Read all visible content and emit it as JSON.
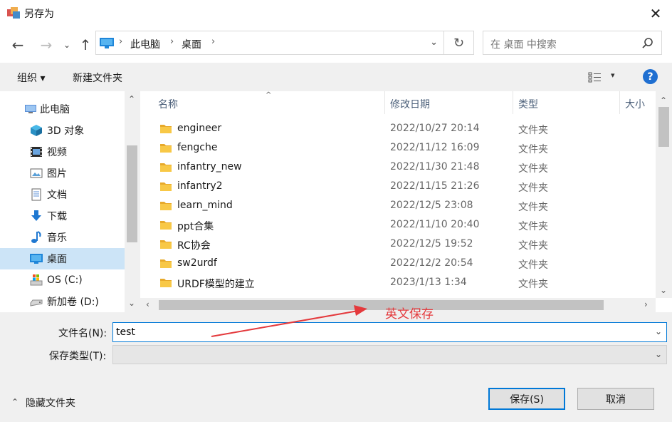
{
  "window": {
    "title": "另存为",
    "close_glyph": "✕"
  },
  "nav": {
    "back_glyph": "←",
    "forward_glyph": "→",
    "recent_glyph": "⌄",
    "up_glyph": "↑",
    "chevron_glyph": "›",
    "breadcrumbs": [
      "此电脑",
      "桌面"
    ],
    "dropdown_glyph": "⌄",
    "refresh_glyph": "↻",
    "search_placeholder": "在 桌面 中搜索"
  },
  "toolbar": {
    "organize_label": "组织 ▾",
    "new_folder_label": "新建文件夹",
    "view_arrow": "▾",
    "help_glyph": "?"
  },
  "sidebar": {
    "scroll_up": "⌃",
    "scroll_down": "⌄",
    "items": [
      {
        "label": "此电脑",
        "icon": "computer-icon",
        "selected": false
      },
      {
        "label": "3D 对象",
        "icon": "3d-objects-icon",
        "selected": false
      },
      {
        "label": "视频",
        "icon": "video-icon",
        "selected": false
      },
      {
        "label": "图片",
        "icon": "pictures-icon",
        "selected": false
      },
      {
        "label": "文档",
        "icon": "documents-icon",
        "selected": false
      },
      {
        "label": "下载",
        "icon": "download-icon",
        "selected": false
      },
      {
        "label": "音乐",
        "icon": "music-icon",
        "selected": false
      },
      {
        "label": "桌面",
        "icon": "desktop-icon",
        "selected": true
      },
      {
        "label": "OS (C:)",
        "icon": "os-drive-icon",
        "selected": false
      },
      {
        "label": "新加卷 (D:)",
        "icon": "drive-icon",
        "selected": false
      }
    ]
  },
  "filelist": {
    "sort_arrow": "^",
    "columns": {
      "name": "名称",
      "modified": "修改日期",
      "type": "类型",
      "size": "大小"
    },
    "rows": [
      {
        "name": "engineer",
        "modified": "2022/10/27 20:14",
        "type": "文件夹"
      },
      {
        "name": "fengche",
        "modified": "2022/11/12 16:09",
        "type": "文件夹"
      },
      {
        "name": "infantry_new",
        "modified": "2022/11/30 21:48",
        "type": "文件夹"
      },
      {
        "name": "infantry2",
        "modified": "2022/11/15 21:26",
        "type": "文件夹"
      },
      {
        "name": "learn_mind",
        "modified": "2022/12/5 23:08",
        "type": "文件夹"
      },
      {
        "name": "ppt合集",
        "modified": "2022/11/10 20:40",
        "type": "文件夹"
      },
      {
        "name": "RC协会",
        "modified": "2022/12/5 19:52",
        "type": "文件夹"
      },
      {
        "name": "sw2urdf",
        "modified": "2022/12/2 20:54",
        "type": "文件夹"
      },
      {
        "name": "URDF模型的建立",
        "modified": "2023/1/13 1:34",
        "type": "文件夹"
      }
    ],
    "vscroll_up": "⌃",
    "vscroll_down": "⌄",
    "hscroll_left": "‹",
    "hscroll_right": "›"
  },
  "form": {
    "filename_label": "文件名(N):",
    "filename_value": "test",
    "filetype_label": "保存类型(T):",
    "filetype_value": "",
    "chevron_glyph": "⌄"
  },
  "footer": {
    "hide_folders_glyph": "⌃",
    "hide_folders_label": "隐藏文件夹",
    "save_label": "保存(S)",
    "cancel_label": "取消"
  },
  "annotation": {
    "text": "英文保存",
    "color": "#e4393c"
  },
  "colors": {
    "folder": "#f8c846",
    "folder_tab": "#e7a92a",
    "accent": "#0078d7",
    "selected_bg": "#cce4f7",
    "help_blue": "#1f6fd1"
  }
}
